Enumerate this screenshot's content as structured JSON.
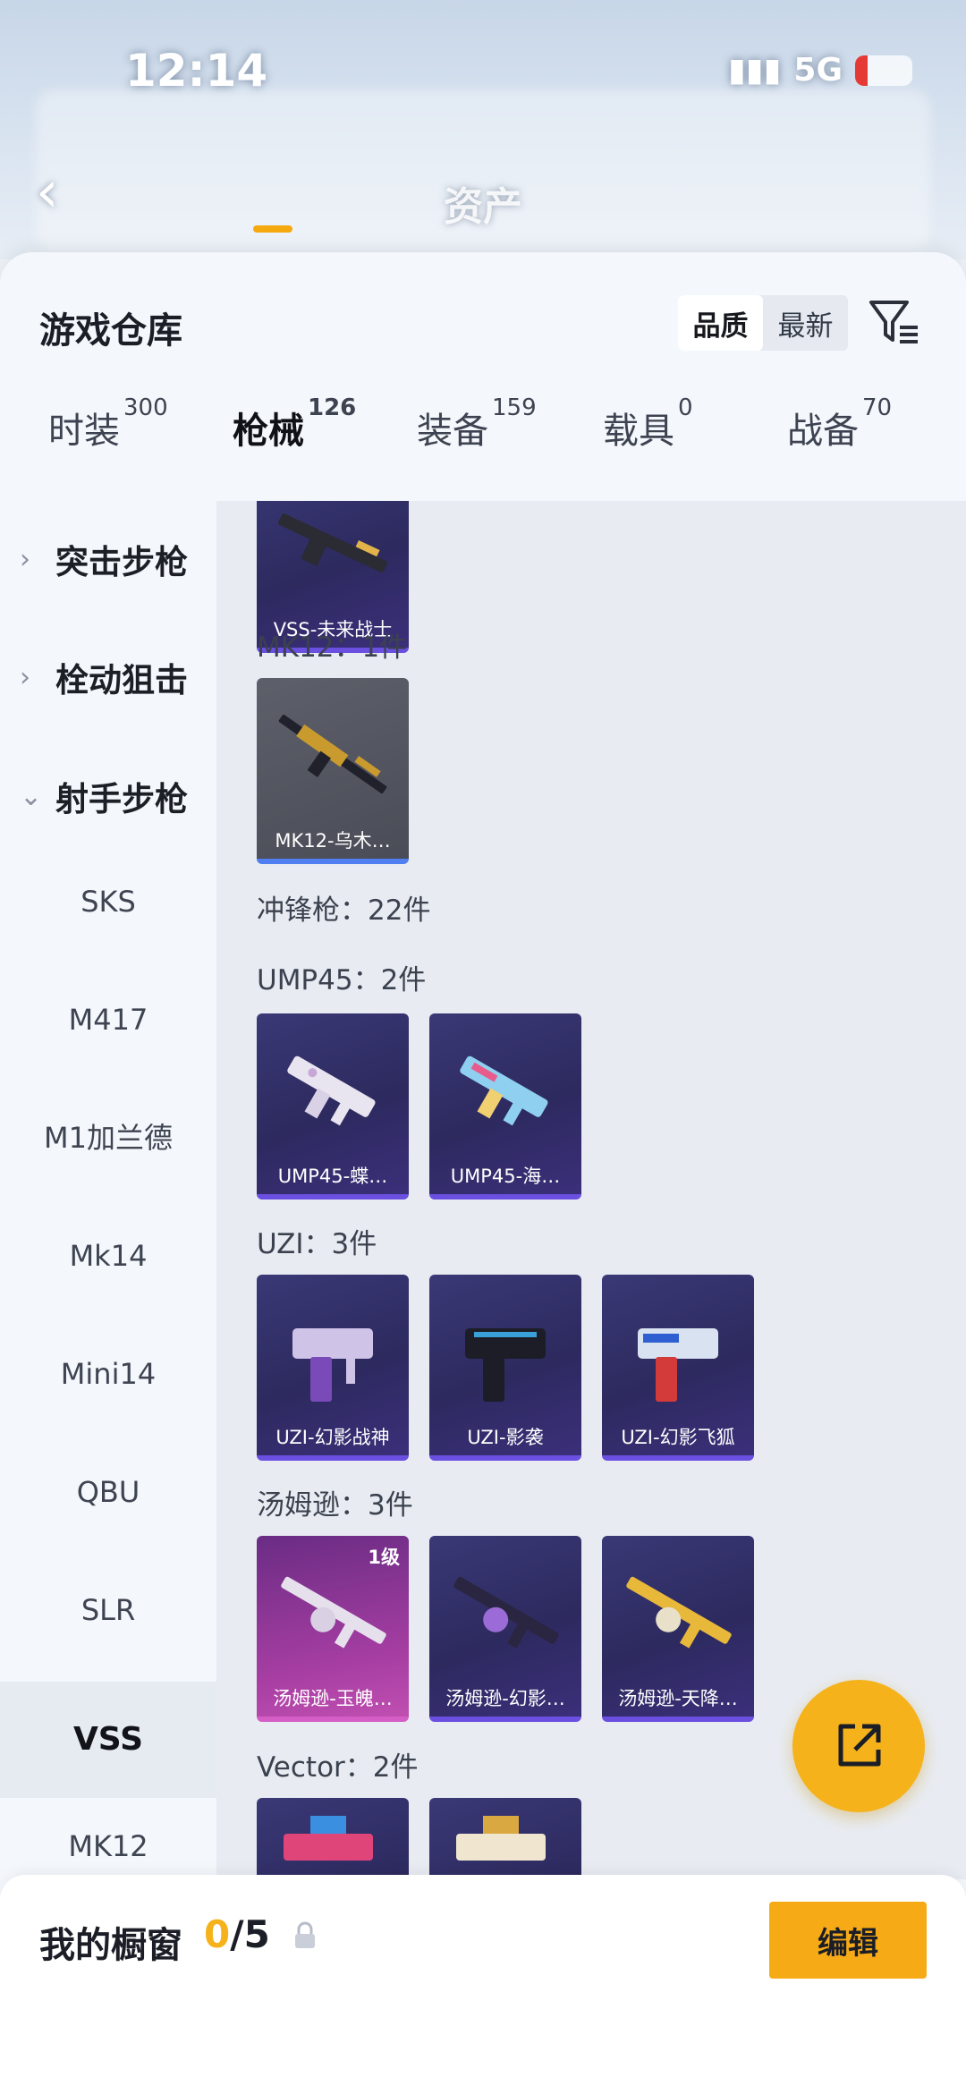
{
  "status": {
    "time": "12:14",
    "network": "5G"
  },
  "header": {
    "back_icon": "chevron-left-icon",
    "title": "资产"
  },
  "sheet": {
    "title": "游戏仓库"
  },
  "sort": {
    "options": [
      "品质",
      "最新"
    ],
    "selected": "品质"
  },
  "tabs": [
    {
      "label": "时装",
      "count": "300"
    },
    {
      "label": "枪械",
      "count": "126"
    },
    {
      "label": "装备",
      "count": "159"
    },
    {
      "label": "载具",
      "count": "0"
    },
    {
      "label": "战备",
      "count": "70"
    }
  ],
  "active_tab": "枪械",
  "accent": "#f5a90f",
  "sidebar": {
    "categories": [
      "突击步枪",
      "栓动狙击",
      "射手步枪"
    ],
    "subitems": [
      "SKS",
      "M417",
      "M1加兰德",
      "Mk14",
      "Mini14",
      "QBU",
      "SLR",
      "VSS",
      "MK12"
    ],
    "selected": "VSS"
  },
  "content": {
    "vss_card": "VSS-未来战士",
    "mk12": {
      "label": "MK12：1件",
      "items": [
        "MK12-乌木…"
      ]
    },
    "smg_header": "冲锋枪：22件",
    "ump45": {
      "label": "UMP45：2件",
      "items": [
        "UMP45-蝶…",
        "UMP45-海…"
      ]
    },
    "uzi": {
      "label": "UZI：3件",
      "items": [
        "UZI-幻影战神",
        "UZI-影袭",
        "UZI-幻影飞狐"
      ]
    },
    "tommy": {
      "label": "汤姆逊：3件",
      "items": [
        "汤姆逊-玉魄…",
        "汤姆逊-幻影…",
        "汤姆逊-天降…"
      ],
      "level_badge": "1级"
    },
    "vector": {
      "label": "Vector：2件"
    }
  },
  "bottom": {
    "title": "我的橱窗",
    "current": "0",
    "total": "/5",
    "edit_label": "编辑"
  }
}
